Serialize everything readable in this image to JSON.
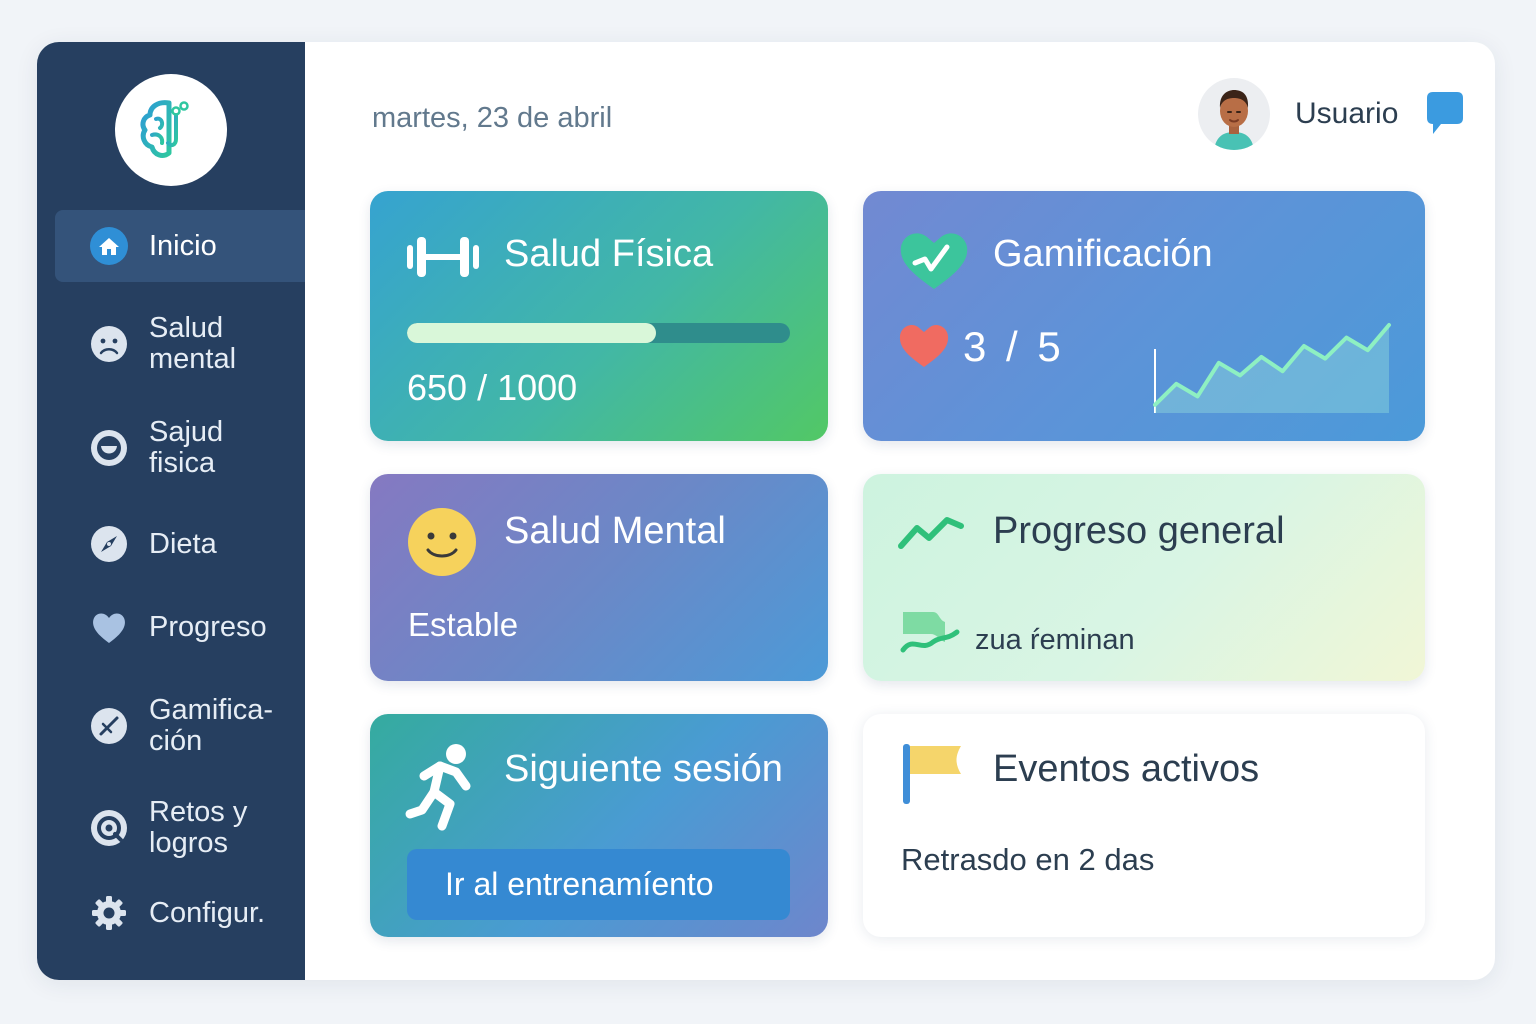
{
  "header": {
    "date": "martes, 23 de abril",
    "username": "Usuario"
  },
  "sidebar": {
    "items": [
      {
        "label": "Inicio",
        "icon": "home-icon",
        "active": true
      },
      {
        "label": "Salud\nmental",
        "icon": "sad-face-icon"
      },
      {
        "label": "Sajud\nfisica",
        "icon": "smile-icon"
      },
      {
        "label": "Dieta",
        "icon": "compass-icon"
      },
      {
        "label": "Progreso",
        "icon": "heart-icon"
      },
      {
        "label": "Gamifica-\nción",
        "icon": "no-icon"
      },
      {
        "label": "Retos y\nlogros",
        "icon": "target-icon"
      },
      {
        "label": "Configur.",
        "icon": "gear-icon"
      }
    ]
  },
  "cards": {
    "fisica": {
      "title": "Salud Física",
      "score": "650 / 1000",
      "progress": 0.65,
      "icon": "dumbbell-icon"
    },
    "gamificacion": {
      "title": "Gamificación",
      "lives": "3 / 5",
      "icon": "heart-check-icon",
      "trend": [
        0.05,
        0.3,
        0.15,
        0.55,
        0.4,
        0.62,
        0.45,
        0.75,
        0.6,
        0.85,
        0.7,
        1.0
      ]
    },
    "mental": {
      "title": "Salud Mental",
      "status": "Estable",
      "icon": "smiley-icon"
    },
    "progreso": {
      "title": "Progreso general",
      "subtitle": "zua ŕeminan",
      "icon": "trend-up-icon"
    },
    "sesion": {
      "title": "Siguiente sesión",
      "button": "Ir al entrenamíento",
      "icon": "runner-icon"
    },
    "eventos": {
      "title": "Eventos activos",
      "text": "Retrasdo en 2 das",
      "icon": "flag-icon"
    }
  },
  "colors": {
    "sidebar": "#263f60",
    "accent": "#3589d2",
    "green": "#52c865"
  }
}
